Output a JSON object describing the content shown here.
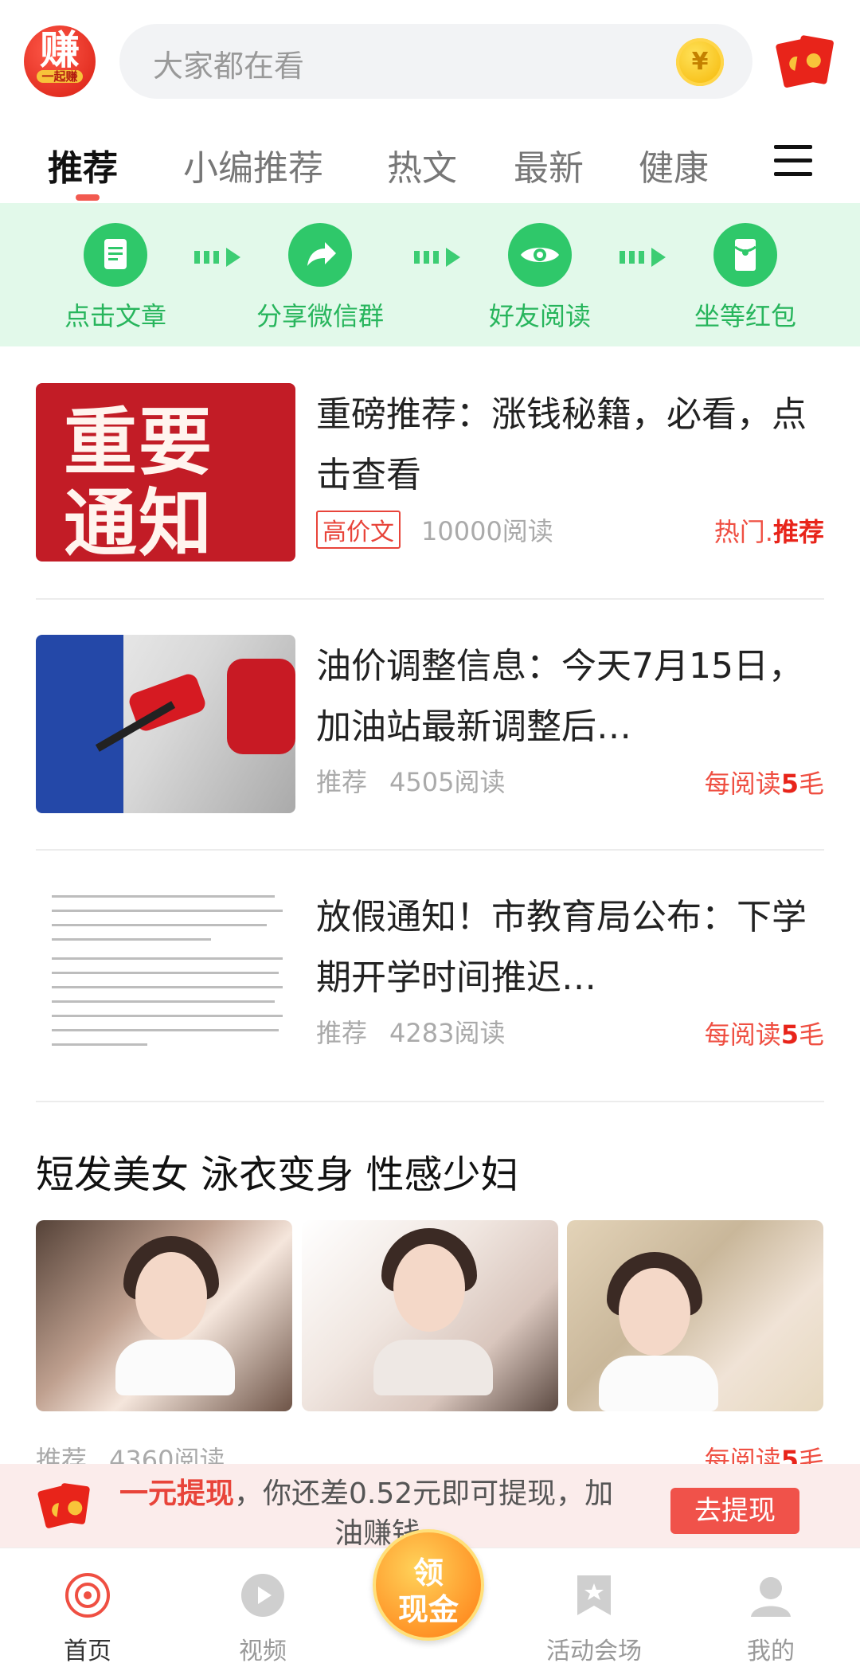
{
  "header": {
    "logo_char": "赚",
    "logo_sub": "一起赚",
    "search_placeholder": "大家都在看",
    "coin_symbol": "¥"
  },
  "tabs": [
    {
      "label": "推荐",
      "active": true
    },
    {
      "label": "小编推荐"
    },
    {
      "label": "热文"
    },
    {
      "label": "最新"
    },
    {
      "label": "健康"
    }
  ],
  "steps": [
    {
      "label": "点击文章",
      "icon": "document-icon"
    },
    {
      "label": "分享微信群",
      "icon": "share-icon"
    },
    {
      "label": "好友阅读",
      "icon": "eye-icon"
    },
    {
      "label": "坐等红包",
      "icon": "red-packet-icon"
    }
  ],
  "articles": [
    {
      "thumb_text_1": "重要",
      "thumb_text_2": "通知",
      "title": "重磅推荐：涨钱秘籍，必看，点击查看",
      "tag": "高价文",
      "reads": "10000阅读",
      "right_prefix": "热门.",
      "right_bold": "推荐"
    },
    {
      "title": "油价调整信息：今天7月15日，加油站最新调整后…",
      "tag": "推荐",
      "reads": "4505阅读",
      "right_prefix": "每阅读",
      "right_bold": "5",
      "right_suffix": "毛"
    },
    {
      "title": "放假通知！市教育局公布：下学期开学时间推迟…",
      "tag": "推荐",
      "reads": "4283阅读",
      "right_prefix": "每阅读",
      "right_bold": "5",
      "right_suffix": "毛"
    }
  ],
  "gallery": {
    "title": "短发美女 泳衣变身 性感少妇",
    "tag": "推荐",
    "reads": "4360阅读",
    "right_prefix": "每阅读",
    "right_bold": "5",
    "right_suffix": "毛"
  },
  "withdraw": {
    "highlight": "一元提现",
    "message": "，你还差0.52元即可提现，加",
    "message_line2": "油赚钱",
    "button": "去提现"
  },
  "cash_button": {
    "line1": "领",
    "line2": "现金"
  },
  "bottom_nav": [
    {
      "label": "首页",
      "icon": "home-target-icon",
      "active": true
    },
    {
      "label": "视频",
      "icon": "play-icon"
    },
    {
      "label": "活动会场",
      "icon": "star-bookmark-icon"
    },
    {
      "label": "我的",
      "icon": "user-icon"
    }
  ],
  "colors": {
    "accent_red": "#e8443a",
    "green": "#2fc86a",
    "banner_bg": "#e2f9ea"
  }
}
